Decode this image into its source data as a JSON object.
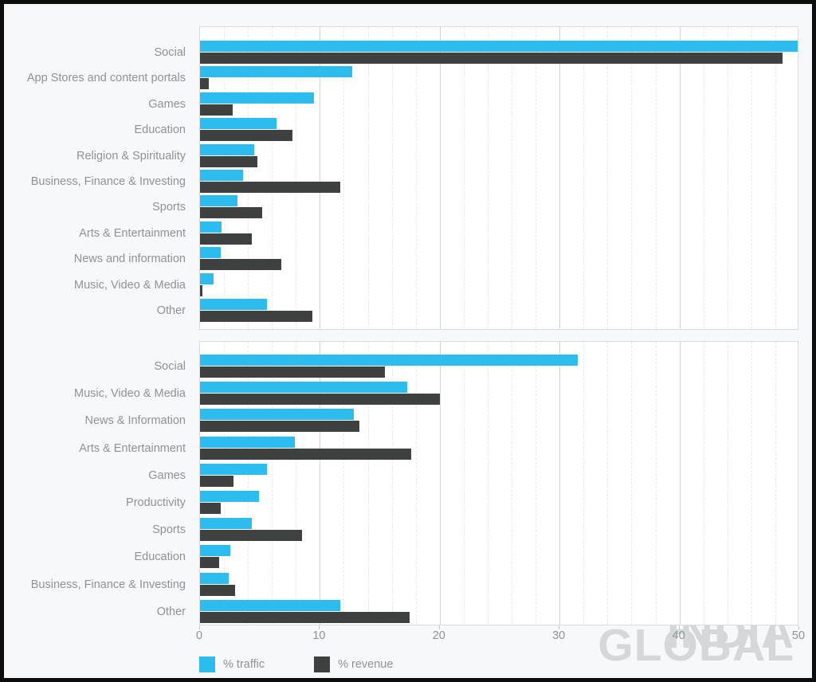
{
  "colors": {
    "traffic": "#2cbdee",
    "revenue": "#3f4040",
    "background": "#f6f8f9",
    "plot_background": "#ffffff",
    "text": "#8e9396",
    "watermark": "#d4d8da",
    "border": "#0d0d0d"
  },
  "legend": {
    "position": "bottom-left",
    "items": [
      {
        "label": "% traffic",
        "color": "#2cbdee",
        "swatch": "traffic-swatch"
      },
      {
        "label": "% revenue",
        "color": "#3f4040",
        "swatch": "revenue-swatch"
      }
    ]
  },
  "axis": {
    "ticks": [
      "0",
      "10",
      "20",
      "30",
      "40",
      "50"
    ],
    "min": 0,
    "max": 50,
    "step": 10,
    "minor_step": 2
  },
  "panels": [
    {
      "id": "india",
      "watermark": "INDIA"
    },
    {
      "id": "global",
      "watermark": "GLOBAL"
    }
  ],
  "chart_data": [
    {
      "type": "bar",
      "orientation": "horizontal",
      "title": "INDIA",
      "xlabel": "",
      "ylabel": "",
      "xlim": [
        0,
        50
      ],
      "grid": true,
      "legend_position": "bottom-left",
      "categories": [
        "Social",
        "App Stores and content portals",
        "Games",
        "Education",
        "Religion & Spirituality",
        "Business, Finance & Investing",
        "Sports",
        "Arts & Entertainment",
        "News and information",
        "Music, Video & Media",
        "Other"
      ],
      "series": [
        {
          "name": "% traffic",
          "color": "#2cbdee",
          "values": [
            50.0,
            12.7,
            9.5,
            6.4,
            4.5,
            3.6,
            3.1,
            1.8,
            1.7,
            1.1,
            5.6
          ]
        },
        {
          "name": "% revenue",
          "color": "#3f4040",
          "values": [
            48.6,
            0.7,
            2.7,
            7.7,
            4.8,
            11.7,
            5.2,
            4.3,
            6.8,
            0.2,
            9.4
          ]
        }
      ]
    },
    {
      "type": "bar",
      "orientation": "horizontal",
      "title": "GLOBAL",
      "xlabel": "",
      "ylabel": "",
      "xlim": [
        0,
        50
      ],
      "grid": true,
      "legend_position": "bottom-left",
      "categories": [
        "Social",
        "Music, Video & Media",
        "News & Information",
        "Arts & Entertainment",
        "Games",
        "Productivity",
        "Sports",
        "Education",
        "Business, Finance & Investing",
        "Other"
      ],
      "series": [
        {
          "name": "% traffic",
          "color": "#2cbdee",
          "values": [
            31.5,
            17.3,
            12.8,
            7.9,
            5.6,
            4.9,
            4.3,
            2.5,
            2.4,
            11.7
          ]
        },
        {
          "name": "% revenue",
          "color": "#3f4040",
          "values": [
            15.4,
            20.0,
            13.3,
            17.6,
            2.8,
            1.7,
            8.5,
            1.6,
            2.9,
            17.5
          ]
        }
      ]
    }
  ]
}
